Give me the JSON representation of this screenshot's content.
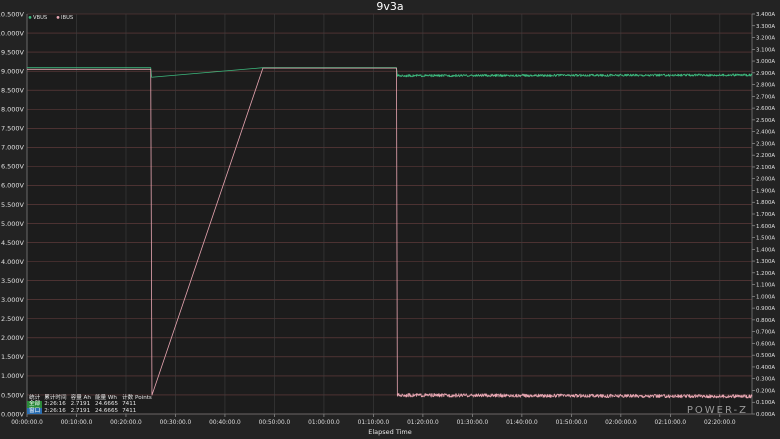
{
  "chart_data": {
    "type": "line",
    "title": "9v3a",
    "xlabel": "Elapsed Time",
    "x_unit": "seconds",
    "xlim": [
      0,
      8790
    ],
    "x_ticks": [
      "00:00:00.0",
      "00:10:00.0",
      "00:20:00.0",
      "00:30:00.0",
      "00:40:00.0",
      "00:50:00.0",
      "01:00:00.0",
      "01:10:00.0",
      "01:20:00.0",
      "01:30:00.0",
      "01:40:00.0",
      "01:50:00.0",
      "02:00:00.0",
      "02:10:00.0",
      "02:20:00.0"
    ],
    "y_left": {
      "ylim": [
        0,
        10.5
      ],
      "ticks": [
        "0.000V",
        "0.500V",
        "1.000V",
        "1.500V",
        "2.000V",
        "2.500V",
        "3.000V",
        "3.500V",
        "4.000V",
        "4.500V",
        "5.000V",
        "5.500V",
        "6.000V",
        "6.500V",
        "7.000V",
        "7.500V",
        "8.000V",
        "8.500V",
        "9.000V",
        "9.500V",
        "10.000V",
        "10.500V"
      ]
    },
    "y_right": {
      "ylim": [
        0,
        3.4
      ],
      "ticks": [
        "0.000A",
        "0.100A",
        "0.200A",
        "0.300A",
        "0.400A",
        "0.500A",
        "0.600A",
        "0.700A",
        "0.800A",
        "0.900A",
        "1.000A",
        "1.100A",
        "1.200A",
        "1.300A",
        "1.400A",
        "1.500A",
        "1.600A",
        "1.700A",
        "1.800A",
        "1.900A",
        "2.000A",
        "2.100A",
        "2.200A",
        "2.300A",
        "2.400A",
        "2.500A",
        "2.600A",
        "2.700A",
        "2.800A",
        "2.900A",
        "3.000A",
        "3.100A",
        "3.200A",
        "3.300A",
        "3.400A"
      ]
    },
    "legend": {
      "placement": "top-left",
      "entries": [
        "VBUS",
        "IBUS"
      ]
    },
    "grid": true,
    "series": [
      {
        "name": "VBUS",
        "axis": "left",
        "color": "#3dba7e",
        "x": [
          0,
          1500,
          1510,
          2860,
          2880,
          4480,
          4490,
          8790
        ],
        "y": [
          9.09,
          9.09,
          8.84,
          9.09,
          9.09,
          9.09,
          8.88,
          8.9
        ],
        "noise_from_x": 4490,
        "noise_amplitude": 0.03
      },
      {
        "name": "IBUS",
        "axis": "right",
        "color": "#e8a6b2",
        "x": [
          0,
          1500,
          1515,
          2860,
          2890,
          4480,
          4490,
          8790
        ],
        "y": [
          2.93,
          2.93,
          0.16,
          2.94,
          2.94,
          2.94,
          0.16,
          0.15
        ],
        "noise_from_x": 4490,
        "noise_amplitude": 0.015
      }
    ]
  },
  "stats": {
    "headers": [
      "统计",
      "累计时间",
      "容量 Ah",
      "能量 Wh",
      "计数 Points"
    ],
    "rows": [
      {
        "tag": "全部",
        "time": "2:26:16",
        "ah": "2.7191",
        "wh": "24.6665",
        "points": "7411"
      },
      {
        "tag": "窗口",
        "time": "2:26:16",
        "ah": "2.7191",
        "wh": "24.6665",
        "points": "7411"
      }
    ]
  },
  "brand": "POWER-Z",
  "colors": {
    "grid_h": "#6a3f3f",
    "grid_v": "#3e3e3e",
    "axis": "#7a7a7a"
  }
}
